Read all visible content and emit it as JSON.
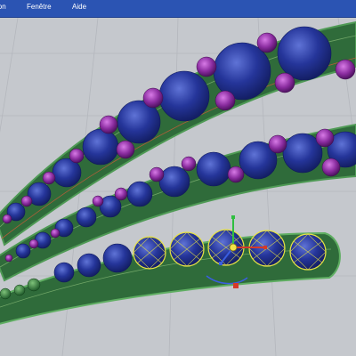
{
  "menubar": {
    "items": [
      {
        "label": "ion"
      },
      {
        "label": "Fenêtre"
      },
      {
        "label": "Aide"
      }
    ]
  },
  "viewport": {
    "background_color": "#c5c8cd",
    "grid_color": "#b7bac0",
    "band_color": "#2f6b3a",
    "band_edge_color": "#4f9a55",
    "sapphire_color": "#1f2f8f",
    "amethyst_color": "#8a2c9f",
    "selected_outline_color": "#e7e245",
    "gizmo_colors": {
      "x": "#d43a2a",
      "y": "#2fbf40",
      "z": "#3a5ee0"
    }
  }
}
